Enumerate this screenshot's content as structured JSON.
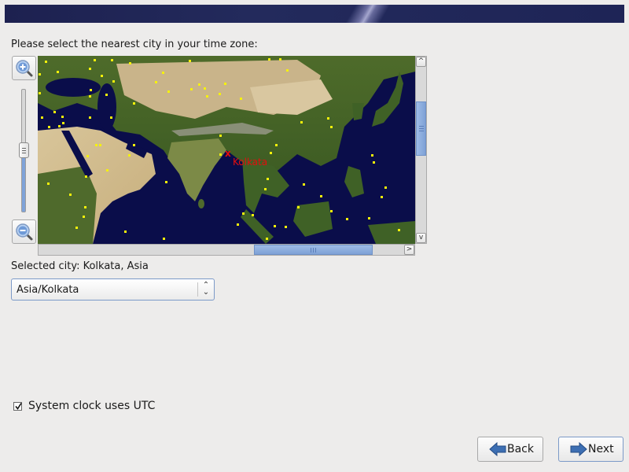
{
  "header": {
    "banner": "installer-banner"
  },
  "timezone": {
    "prompt": "Please select the nearest city in your time zone:",
    "zoom_in_icon": "zoom-in-magnifier-icon",
    "zoom_out_icon": "zoom-out-magnifier-icon",
    "zoom_level": 0.52,
    "map": {
      "region_shown": "Middle East, South Asia, East Asia",
      "selected_marker": "x",
      "selected_label": "Kolkata",
      "colors": {
        "marker": "#e30e0e",
        "city_dot": "#f5f20a",
        "ocean": "#0a0d4a"
      }
    },
    "vertical_scroll_icons": {
      "up": "^",
      "down": "v"
    },
    "horizontal_scroll_icons": {
      "left": "<",
      "right": ">"
    },
    "selected_city_label": "Selected city: Kolkata, Asia",
    "combo": {
      "value": "Asia/Kolkata",
      "arrows": "⌃⌄"
    },
    "utc": {
      "label": "System clock uses UTC",
      "checked": true
    }
  },
  "footer": {
    "back_label": "Back",
    "next_label": "Next"
  }
}
